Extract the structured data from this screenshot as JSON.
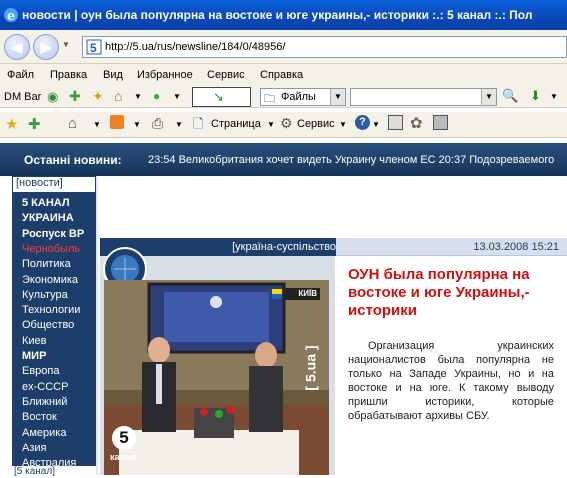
{
  "window": {
    "title": "новости | оун была популярна на востоке и юге украины,- историки :.: 5 канал :.: Пол"
  },
  "address": {
    "url": "http://5.ua/rus/newsline/184/0/48956/"
  },
  "menu": [
    "Файл",
    "Правка",
    "Вид",
    "Избранное",
    "Сервис",
    "Справка"
  ],
  "toolbar1": {
    "dm_bar": "DM Bar",
    "files_label": "Файлы"
  },
  "toolbar2": {
    "page_label": "Страница",
    "service_label": "Сервис"
  },
  "news_ticker": {
    "label": "Останні новини:",
    "text": "23:54 Великобритания хочет видеть Украину членом ЕС    20:37 Подозреваемого"
  },
  "sidebar": {
    "tab": "[новости]",
    "items": [
      {
        "label": "5 КАНАЛ",
        "style": "b"
      },
      {
        "label": "УКРАИНА",
        "style": "b"
      },
      {
        "label": "Роспуск ВР",
        "style": "b"
      },
      {
        "label": "Чернобыль",
        "style": "red"
      },
      {
        "label": "Политика",
        "style": ""
      },
      {
        "label": "Экономика",
        "style": ""
      },
      {
        "label": "Культура",
        "style": ""
      },
      {
        "label": "Технологии",
        "style": ""
      },
      {
        "label": "Общество",
        "style": ""
      },
      {
        "label": "Киев",
        "style": ""
      },
      {
        "label": "МИР",
        "style": "b"
      },
      {
        "label": "Европа",
        "style": ""
      },
      {
        "label": "ex-СССР",
        "style": ""
      },
      {
        "label": "Ближний",
        "style": ""
      },
      {
        "label": "Восток",
        "style": ""
      },
      {
        "label": "Америка",
        "style": ""
      },
      {
        "label": "Азия",
        "style": ""
      },
      {
        "label": "Австралия",
        "style": ""
      }
    ],
    "bottom_tab": "[5 канал]"
  },
  "article": {
    "category": "[україна-суспільство]",
    "date": "13.03.2008 15:21",
    "headline": "ОУН была популярна на востоке и юге Украины,- историки",
    "body": "Организация украинских националистов была популярна не только на Западе Украины, но и на востоке и на юге. К такому выводу пришли историки, которые обрабатывают архивы СБУ.",
    "video_logo_number": "5",
    "video_logo_text": "канал",
    "video_side_text": "[ 5.ua ]",
    "video_kiev_badge": "КИЇВ"
  },
  "colors": {
    "titlebar": "#0a5fd8",
    "navy": "#1d3d6b",
    "headline_red": "#cc1111"
  }
}
